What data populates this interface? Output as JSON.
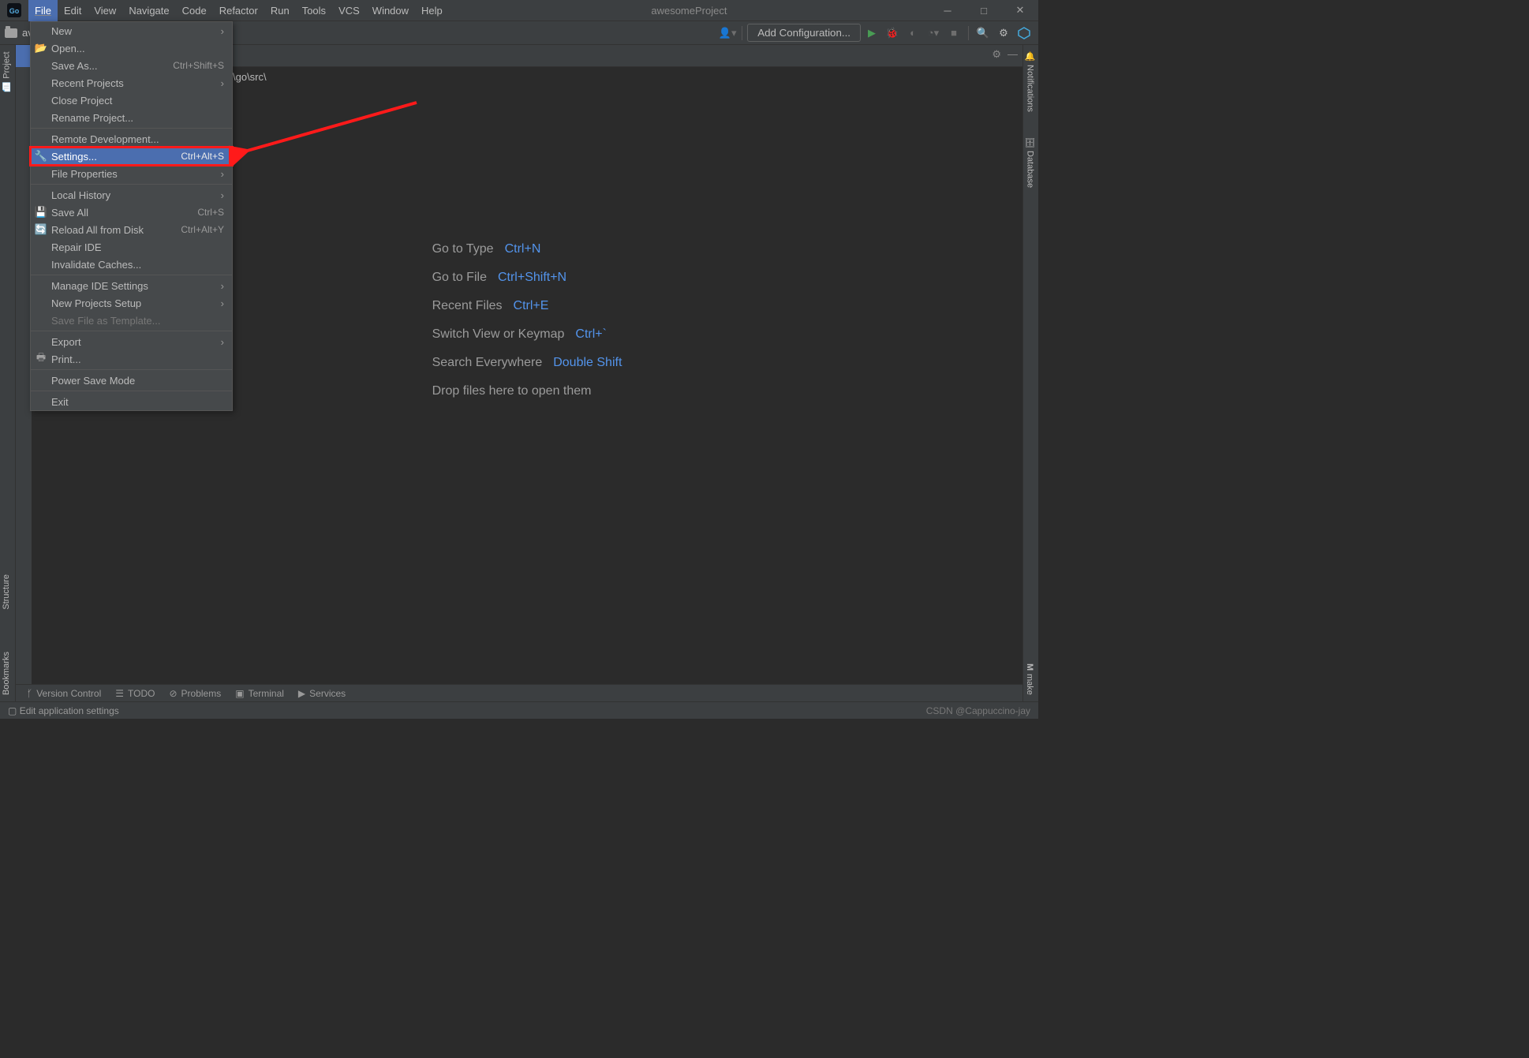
{
  "project_name": "awesomeProject",
  "menubar": [
    "File",
    "Edit",
    "View",
    "Navigate",
    "Code",
    "Refactor",
    "Run",
    "Tools",
    "VCS",
    "Window",
    "Help"
  ],
  "toolbar": {
    "breadcrumb": "av",
    "add_config": "Add Configuration..."
  },
  "breadcrumb_path": "\\go\\src\\",
  "file_menu": [
    {
      "label": "New",
      "arrow": true
    },
    {
      "label": "Open...",
      "icon": "folder"
    },
    {
      "label": "Save As...",
      "shortcut": "Ctrl+Shift+S"
    },
    {
      "label": "Recent Projects",
      "arrow": true
    },
    {
      "label": "Close Project"
    },
    {
      "label": "Rename Project..."
    },
    {
      "sep": true
    },
    {
      "label": "Remote Development..."
    },
    {
      "label": "Settings...",
      "shortcut": "Ctrl+Alt+S",
      "icon": "wrench",
      "hl": true
    },
    {
      "label": "File Properties",
      "arrow": true
    },
    {
      "sep": true
    },
    {
      "label": "Local History",
      "arrow": true
    },
    {
      "label": "Save All",
      "shortcut": "Ctrl+S",
      "icon": "save"
    },
    {
      "label": "Reload All from Disk",
      "shortcut": "Ctrl+Alt+Y",
      "icon": "reload"
    },
    {
      "label": "Repair IDE"
    },
    {
      "label": "Invalidate Caches..."
    },
    {
      "sep": true
    },
    {
      "label": "Manage IDE Settings",
      "arrow": true
    },
    {
      "label": "New Projects Setup",
      "arrow": true
    },
    {
      "label": "Save File as Template...",
      "disabled": true
    },
    {
      "sep": true
    },
    {
      "label": "Export",
      "arrow": true
    },
    {
      "label": "Print...",
      "icon": "print"
    },
    {
      "sep": true
    },
    {
      "label": "Power Save Mode"
    },
    {
      "sep": true
    },
    {
      "label": "Exit"
    }
  ],
  "hints": [
    {
      "label": "Go to Type",
      "key": "Ctrl+N"
    },
    {
      "label": "Go to File",
      "key": "Ctrl+Shift+N"
    },
    {
      "label": "Recent Files",
      "key": "Ctrl+E"
    },
    {
      "label": "Switch View or Keymap",
      "key": "Ctrl+`"
    },
    {
      "label": "Search Everywhere",
      "key": "Double Shift"
    }
  ],
  "drop_hint": "Drop files here to open them",
  "left_tabs": {
    "project": "Project",
    "structure": "Structure",
    "bookmarks": "Bookmarks"
  },
  "right_tabs": {
    "notifications": "Notifications",
    "database": "Database",
    "make": "make"
  },
  "bottom_tools": [
    "Version Control",
    "TODO",
    "Problems",
    "Terminal",
    "Services"
  ],
  "status_text": "Edit application settings",
  "watermark": "CSDN @Cappuccino-jay"
}
